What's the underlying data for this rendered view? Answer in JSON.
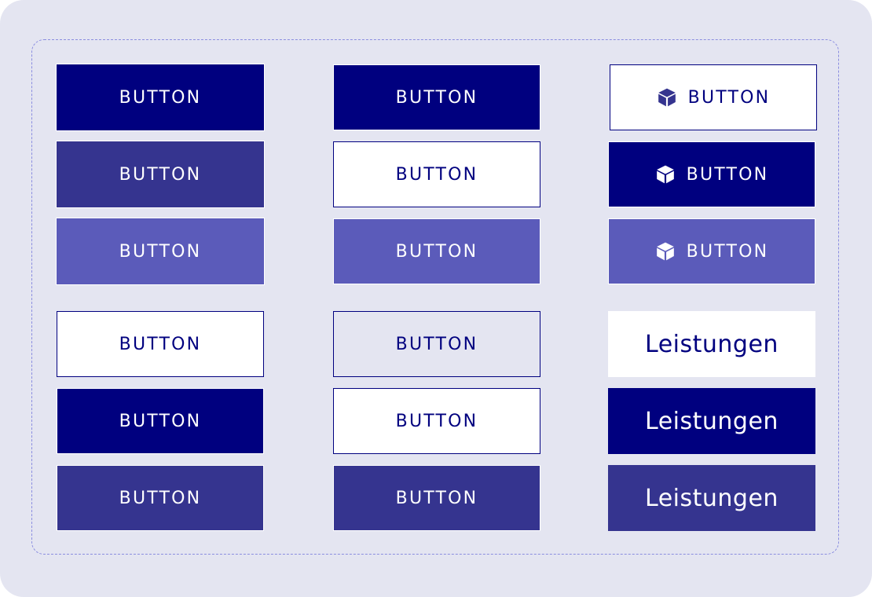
{
  "buttons": {
    "b1": "BUTTON",
    "b2": "BUTTON",
    "b3": "BUTTON",
    "b4": "BUTTON",
    "b5": "BUTTON",
    "b6": "BUTTON",
    "b7": "BUTTON",
    "b8": "BUTTON",
    "b9": "BUTTON",
    "b10": "BUTTON",
    "b11": "BUTTON",
    "b12": "BUTTON",
    "b13": "BUTTON",
    "b14": "BUTTON",
    "b15": "BUTTON",
    "b16": "Leistungen",
    "b17": "Leistungen",
    "b18": "Leistungen"
  },
  "icons": {
    "cube": "cube-icon"
  },
  "colors": {
    "background": "#e4e5f1",
    "navy": "#00007f",
    "indigo": "#35348f",
    "violet": "#5b5bba",
    "white": "#ffffff",
    "dashed_border": "#8a8de0"
  }
}
